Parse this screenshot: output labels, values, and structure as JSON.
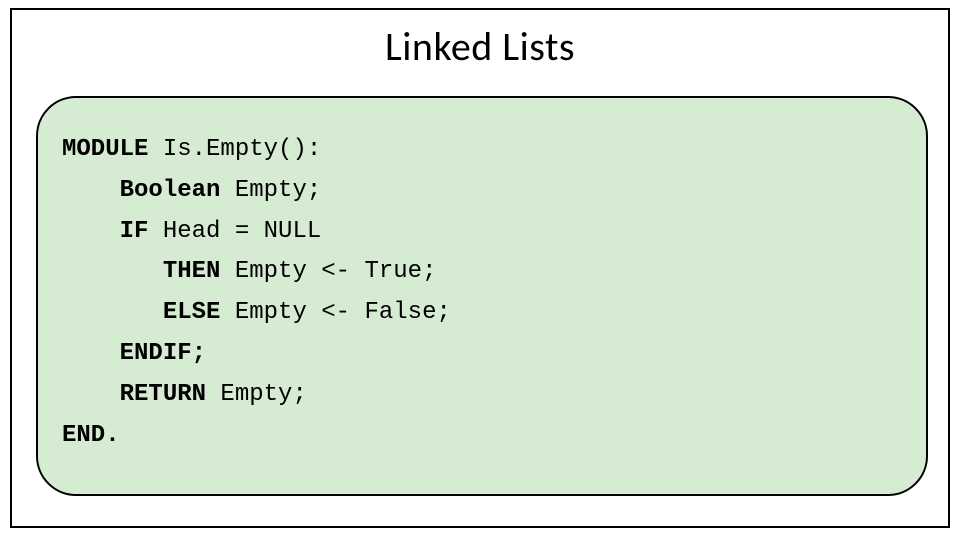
{
  "title": "Linked Lists",
  "code": {
    "l1_kw": "MODULE",
    "l1_rest": " Is.Empty():",
    "l2_kw": "Boolean",
    "l2_rest": " Empty;",
    "l3_kw": "IF",
    "l3_rest": " Head = NULL",
    "l4_kw": "THEN",
    "l4_rest": " Empty <- True;",
    "l5_kw": "ELSE",
    "l5_rest": " Empty <- False;",
    "l6_kw": "ENDIF;",
    "l7_kw": "RETURN",
    "l7_rest": " Empty;",
    "l8_kw": "END."
  }
}
